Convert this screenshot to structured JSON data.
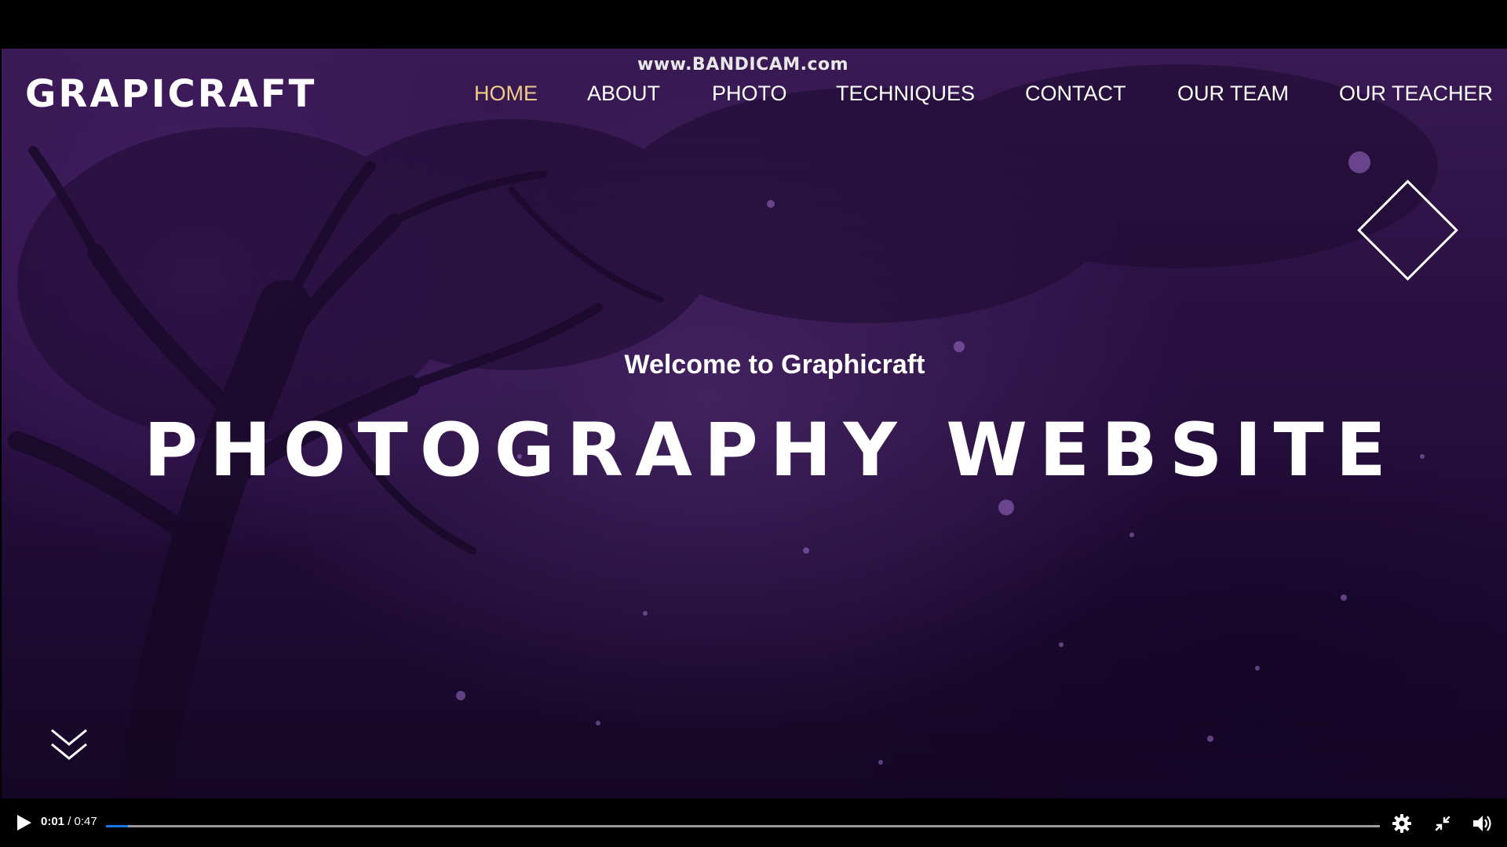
{
  "watermark": "www.BANDICAM.com",
  "site": {
    "logo": "GRAPICRAFT",
    "nav": [
      {
        "label": "HOME",
        "active": true
      },
      {
        "label": "ABOUT",
        "active": false
      },
      {
        "label": "PHOTO",
        "active": false
      },
      {
        "label": "TECHNIQUES",
        "active": false
      },
      {
        "label": "CONTACT",
        "active": false
      },
      {
        "label": "OUR TEAM",
        "active": false
      },
      {
        "label": "OUR TEACHER",
        "active": false
      }
    ],
    "hero": {
      "welcome": "Welcome to Graphicraft",
      "headline": "PHOTOGRAPHY WEBSITE"
    }
  },
  "player": {
    "current_time": "0:01",
    "separator": " / ",
    "duration": "0:47",
    "progress_fraction": 0.017,
    "icons": [
      "play-icon",
      "settings-icon",
      "exit-fullscreen-icon",
      "volume-icon"
    ]
  },
  "colors": {
    "nav_active": "#f0cc8a",
    "progress": "#1a73e8",
    "background": "#2a1042"
  }
}
